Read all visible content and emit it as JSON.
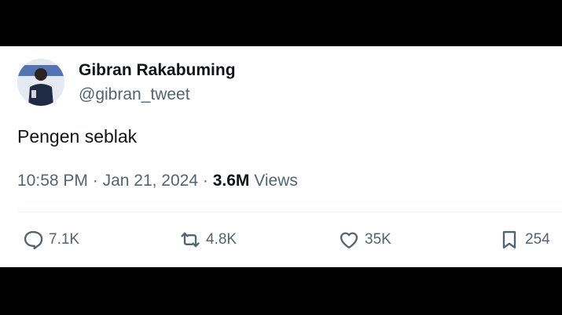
{
  "author": {
    "name": "Gibran Rakabuming",
    "handle": "@gibran_tweet"
  },
  "tweet": {
    "text": "Pengen seblak",
    "time": "10:58 PM",
    "date": "Jan 21, 2024",
    "separator": "·",
    "views_count": "3.6M",
    "views_label": "Views"
  },
  "actions": {
    "replies": "7.1K",
    "reposts": "4.8K",
    "likes": "35K",
    "bookmarks": "254"
  },
  "icons": {
    "reply": "reply-icon",
    "repost": "repost-icon",
    "like": "like-icon",
    "bookmark": "bookmark-icon"
  },
  "colors": {
    "text_primary": "#0f1419",
    "text_secondary": "#536471",
    "background": "#ffffff"
  }
}
